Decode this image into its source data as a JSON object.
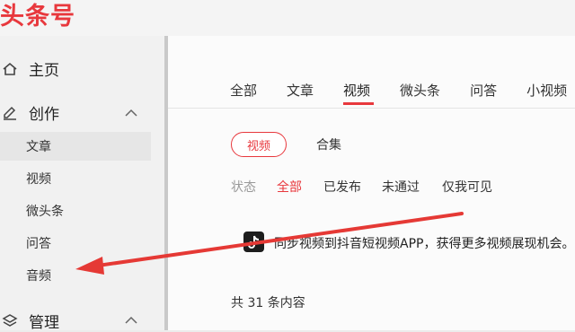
{
  "header": {
    "logo_text": "头条号"
  },
  "sidebar": {
    "home_label": "主页",
    "create_label": "创作",
    "create_items": [
      "文章",
      "视频",
      "微头条",
      "问答",
      "音频"
    ],
    "manage_label": "管理"
  },
  "content": {
    "tabs": [
      "全部",
      "文章",
      "视频",
      "微头条",
      "问答",
      "小视频"
    ],
    "active_tab": "视频",
    "subtabs": {
      "video_pill": "视频",
      "collection": "合集"
    },
    "filters": {
      "label": "状态",
      "all": "全部",
      "published": "已发布",
      "rejected": "未通过",
      "private": "仅我可见"
    },
    "promo": "同步视频到抖音短视频APP，获得更多视频展现机会。",
    "total": "共 31 条内容"
  },
  "colors": {
    "accent": "#e8383d",
    "arrow": "#e53935"
  },
  "icons": [
    "home-icon",
    "edit-icon",
    "layers-icon",
    "chevron-up-icon",
    "douyin-icon"
  ]
}
